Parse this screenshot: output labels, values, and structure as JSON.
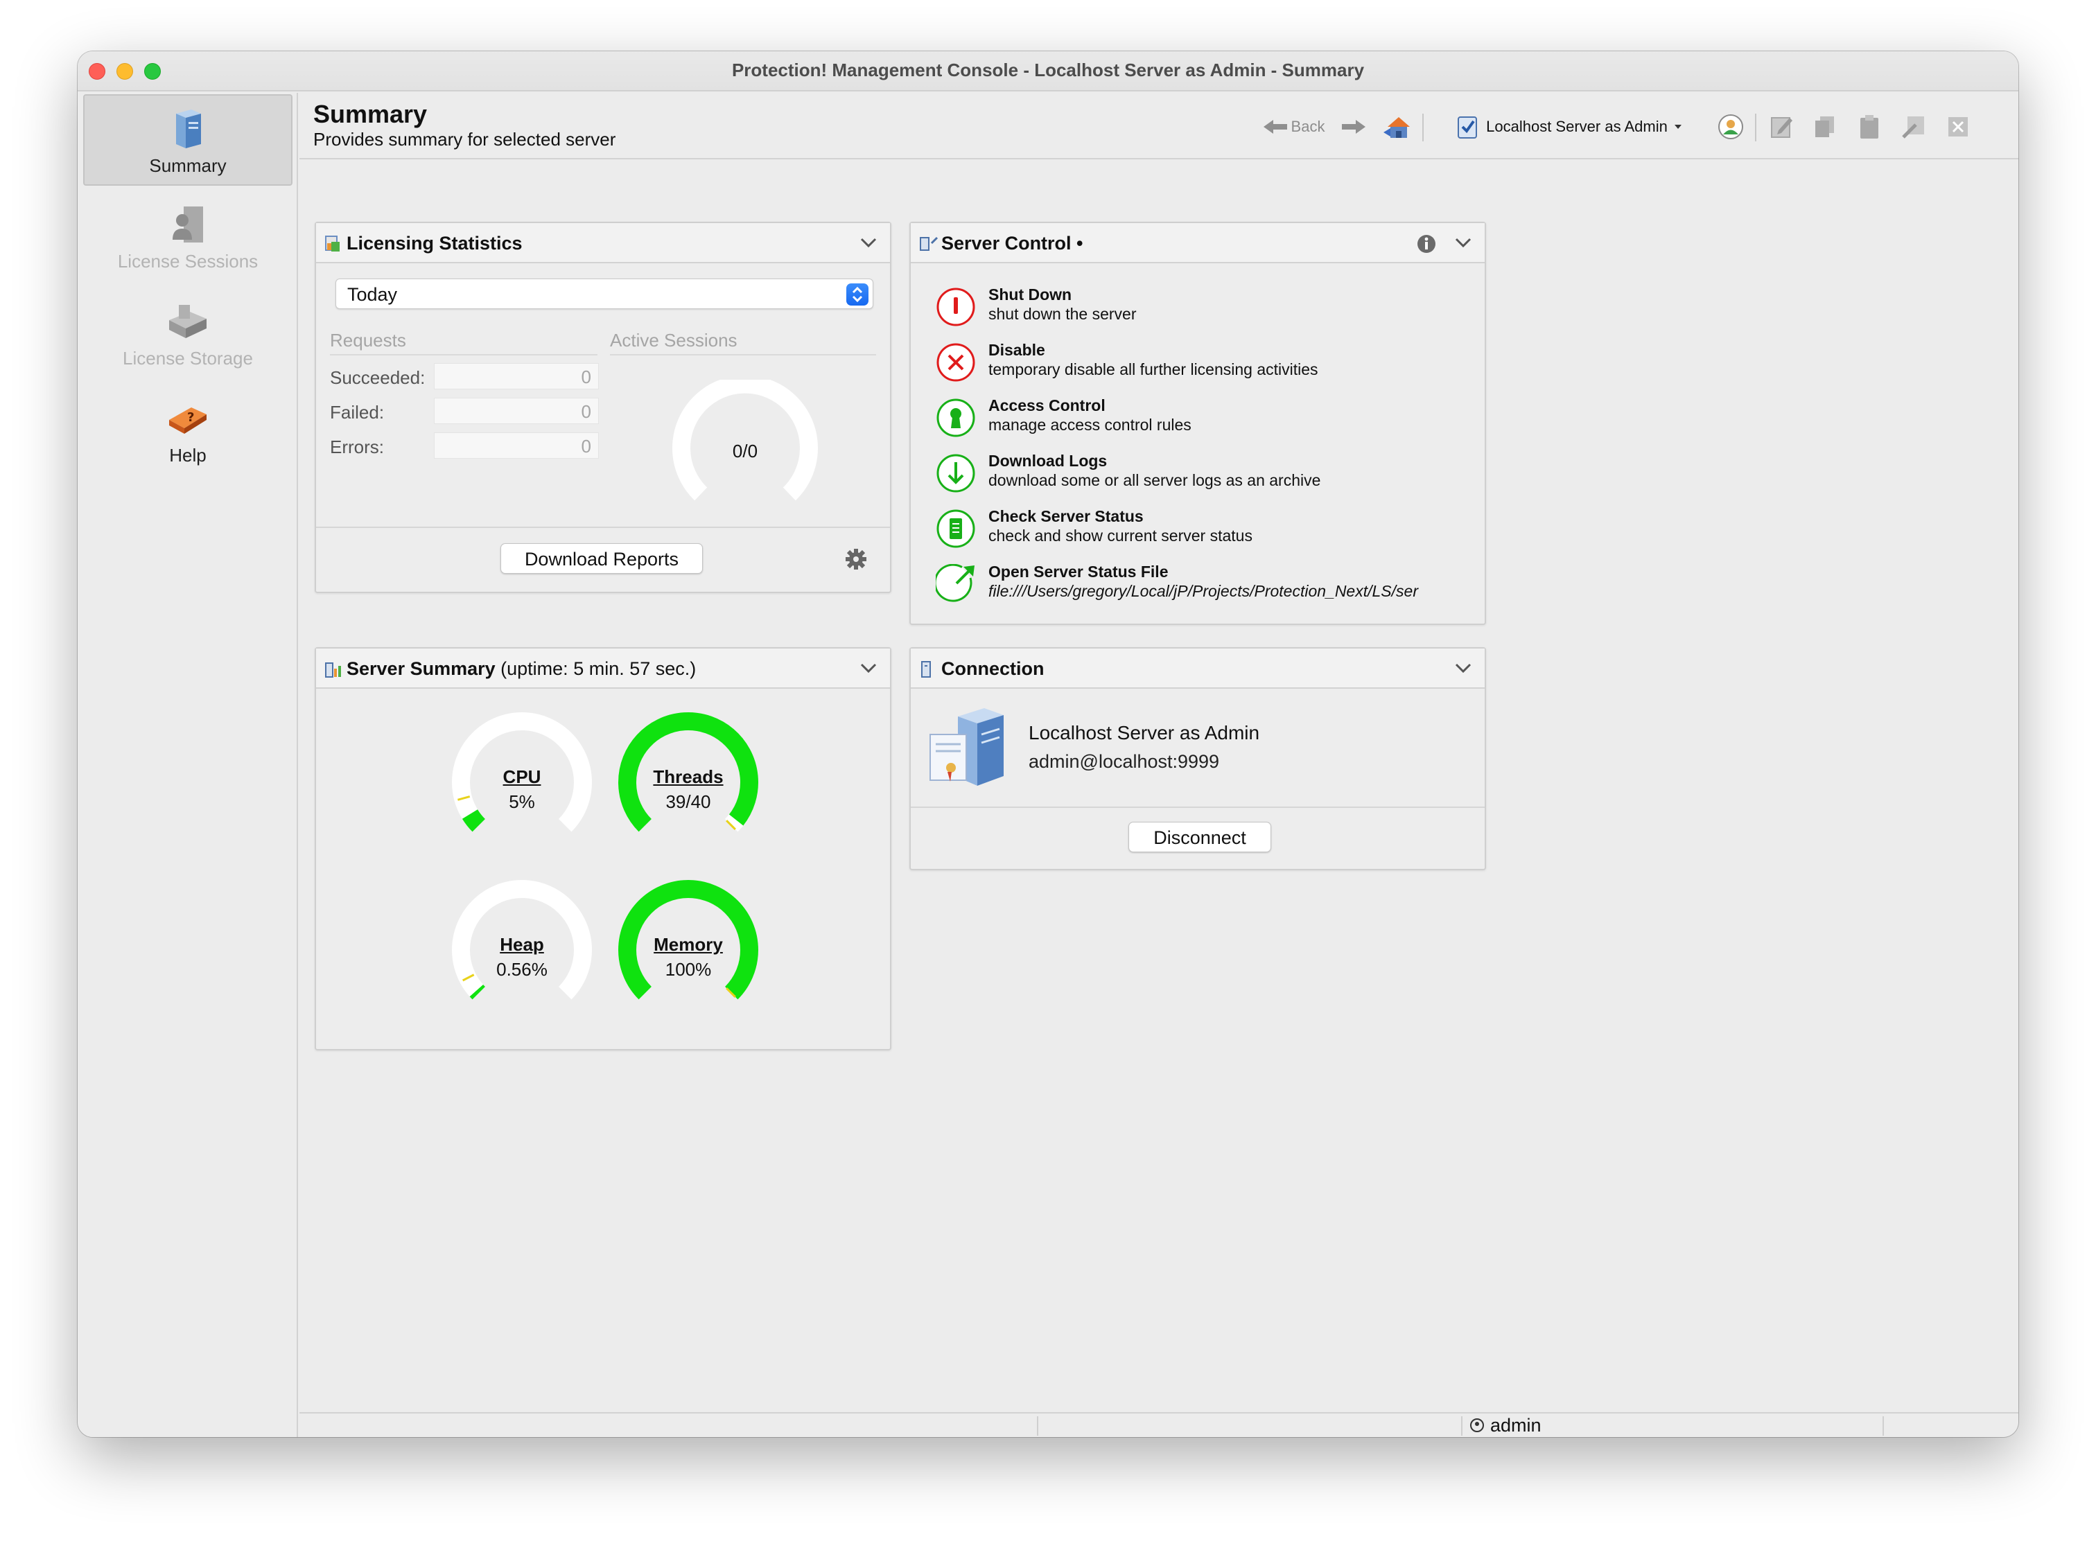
{
  "window": {
    "title": "Protection! Management Console - Localhost Server as Admin - Summary"
  },
  "sidebar": {
    "items": [
      {
        "label": "Summary",
        "state": "active"
      },
      {
        "label": "License Sessions",
        "state": "disabled"
      },
      {
        "label": "License Storage",
        "state": "disabled"
      },
      {
        "label": "Help",
        "state": "enabled"
      }
    ]
  },
  "header": {
    "title": "Summary",
    "subtitle": "Provides summary for selected server"
  },
  "toolbar": {
    "back_label": "Back",
    "server_selector": "Localhost Server as Admin"
  },
  "licensing": {
    "title": "Licensing Statistics",
    "period": "Today",
    "requests_header": "Requests",
    "active_header": "Active Sessions",
    "rows": [
      {
        "label": "Succeeded:",
        "value": "0"
      },
      {
        "label": "Failed:",
        "value": "0"
      },
      {
        "label": "Errors:",
        "value": "0"
      }
    ],
    "active_sessions": "0/0",
    "download_button": "Download Reports"
  },
  "server_control": {
    "title": "Server Control •",
    "actions": [
      {
        "title": "Shut Down",
        "desc": "shut down the server",
        "icon": "stop-icon",
        "color": "#e01b1b"
      },
      {
        "title": "Disable",
        "desc": "temporary disable all further licensing activities",
        "icon": "close-icon",
        "color": "#e01b1b"
      },
      {
        "title": "Access Control",
        "desc": "manage access control rules",
        "icon": "keyhole-icon",
        "color": "#18b018"
      },
      {
        "title": "Download Logs",
        "desc": "download some or all server logs as an archive",
        "icon": "download-icon",
        "color": "#18b018"
      },
      {
        "title": "Check Server Status",
        "desc": "check and show current server status",
        "icon": "document-icon",
        "color": "#18b018"
      },
      {
        "title": "Open Server Status File",
        "desc": "file:///Users/gregory/Local/jP/Projects/Protection_Next/LS/ser",
        "icon": "open-external-icon",
        "color": "#18b018"
      }
    ]
  },
  "server_summary": {
    "title": "Server Summary",
    "uptime": "(uptime: 5 min. 57 sec.)",
    "gauges": [
      {
        "name": "CPU",
        "value": "5%",
        "fraction": 0.05
      },
      {
        "name": "Threads",
        "value": "39/40",
        "fraction": 0.975
      },
      {
        "name": "Heap",
        "value": "0.56%",
        "fraction": 0.0056
      },
      {
        "name": "Memory",
        "value": "100%",
        "fraction": 1.0
      }
    ]
  },
  "connection": {
    "title": "Connection",
    "server_name": "Localhost Server as Admin",
    "address": "admin@localhost:9999",
    "disconnect_button": "Disconnect"
  },
  "statusbar": {
    "user": "admin"
  },
  "colors": {
    "gauge_green": "#0fe20f",
    "gauge_track": "#ffffff",
    "accent_blue": "#1769f0"
  }
}
